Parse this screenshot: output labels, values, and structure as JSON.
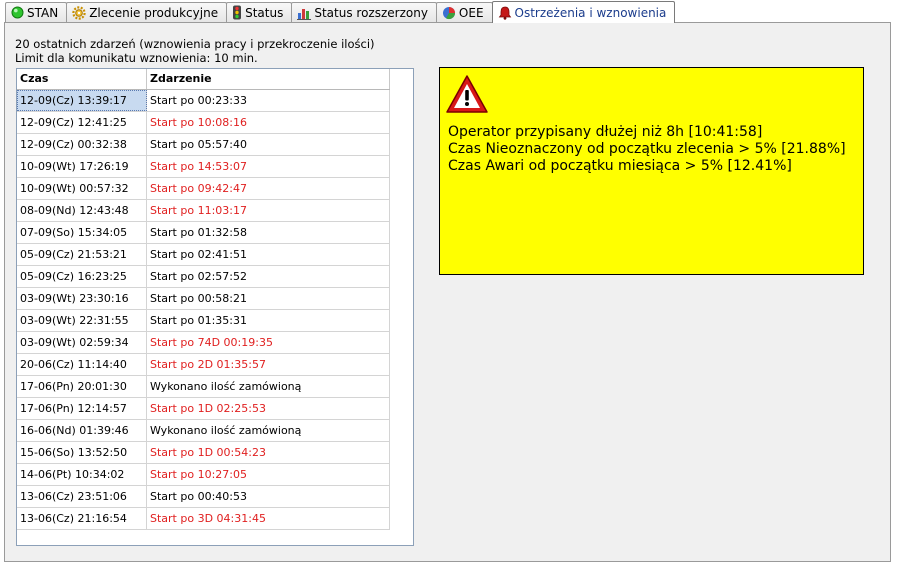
{
  "tabs": [
    {
      "label": "STAN",
      "icon": "green-circle-icon"
    },
    {
      "label": "Zlecenie produkcyjne",
      "icon": "gear-icon"
    },
    {
      "label": "Status",
      "icon": "traffic-light-icon"
    },
    {
      "label": "Status rozszerzony",
      "icon": "bar-chart-icon"
    },
    {
      "label": "OEE",
      "icon": "pie-chart-icon"
    },
    {
      "label": "Ostrzeżenia i wznowienia",
      "icon": "alarm-bell-icon",
      "active": true
    }
  ],
  "info": {
    "line1": "20 ostatnich zdarzeń (wznowienia pracy i przekroczenie ilości)",
    "line2": "Limit dla komunikatu wznowienia: 10 min."
  },
  "table": {
    "headers": [
      "Czas",
      "Zdarzenie"
    ],
    "rows": [
      {
        "time": "12-09(Cz) 13:39:17",
        "event": "Start po 00:23:33",
        "alert": false
      },
      {
        "time": "12-09(Cz) 12:41:25",
        "event": "Start po 10:08:16",
        "alert": true
      },
      {
        "time": "12-09(Cz) 00:32:38",
        "event": "Start po 05:57:40",
        "alert": false
      },
      {
        "time": "10-09(Wt) 17:26:19",
        "event": "Start po 14:53:07",
        "alert": true
      },
      {
        "time": "10-09(Wt) 00:57:32",
        "event": "Start po 09:42:47",
        "alert": true
      },
      {
        "time": "08-09(Nd) 12:43:48",
        "event": "Start po 11:03:17",
        "alert": true
      },
      {
        "time": "07-09(So) 15:34:05",
        "event": "Start po 01:32:58",
        "alert": false
      },
      {
        "time": "05-09(Cz) 21:53:21",
        "event": "Start po 02:41:51",
        "alert": false
      },
      {
        "time": "05-09(Cz) 16:23:25",
        "event": "Start po 02:57:52",
        "alert": false
      },
      {
        "time": "03-09(Wt) 23:30:16",
        "event": "Start po 00:58:21",
        "alert": false
      },
      {
        "time": "03-09(Wt) 22:31:55",
        "event": "Start po 01:35:31",
        "alert": false
      },
      {
        "time": "03-09(Wt) 02:59:34",
        "event": "Start po 74D 00:19:35",
        "alert": true
      },
      {
        "time": "20-06(Cz) 11:14:40",
        "event": "Start po 2D 01:35:57",
        "alert": true
      },
      {
        "time": "17-06(Pn) 20:01:30",
        "event": "Wykonano ilość zamówioną",
        "alert": false
      },
      {
        "time": "17-06(Pn) 12:14:57",
        "event": "Start po 1D 02:25:53",
        "alert": true
      },
      {
        "time": "16-06(Nd) 01:39:46",
        "event": "Wykonano ilość zamówioną",
        "alert": false
      },
      {
        "time": "15-06(So) 13:52:50",
        "event": "Start po 1D 00:54:23",
        "alert": true
      },
      {
        "time": "14-06(Pt) 10:34:02",
        "event": "Start po 10:27:05",
        "alert": true
      },
      {
        "time": "13-06(Cz) 23:51:06",
        "event": "Start po 00:40:53",
        "alert": false
      },
      {
        "time": "13-06(Cz) 21:16:54",
        "event": "Start po 3D 04:31:45",
        "alert": true
      }
    ]
  },
  "warning": {
    "icon": "warning-triangle-icon",
    "lines": [
      "Operator przypisany dłużej niż 8h [10:41:58]",
      "Czas Nieoznaczony od początku zlecenia > 5% [21.88%]",
      "Czas Awari od początku miesiąca > 5% [12.41%]"
    ]
  },
  "colors": {
    "alert_text": "#e02020",
    "warning_bg": "#ffff00",
    "selection": "#c8daf0",
    "active_tab_text": "#1b3c8c"
  }
}
